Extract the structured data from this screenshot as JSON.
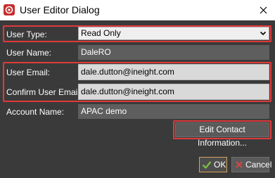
{
  "window": {
    "title": "User Editor Dialog",
    "close_glyph": "✕"
  },
  "form": {
    "user_type_label": "User Type:",
    "user_type_value": "Read Only",
    "user_name_label": "User Name:",
    "user_name_value": "DaleRO",
    "user_email_label": "User Email:",
    "user_email_value": "dale.dutton@ineight.com",
    "confirm_email_label": "Confirm User Email:",
    "confirm_email_value": "dale.dutton@ineight.com",
    "account_name_label": "Account Name:",
    "account_name_value": "APAC demo"
  },
  "buttons": {
    "edit_contact_label": "Edit Contact Information...",
    "ok_label": "OK",
    "cancel_label": "Cancel"
  },
  "colors": {
    "background": "#3a3a3a",
    "highlight": "#e0393b",
    "ok_check": "#7cc242",
    "cancel_x": "#d64545",
    "app_icon": "#c62d2d"
  },
  "icons": {
    "app": "app-logo-icon",
    "close": "close-icon",
    "dropdown": "chevron-down-icon",
    "ok": "checkmark-icon",
    "cancel": "x-mark-icon"
  }
}
